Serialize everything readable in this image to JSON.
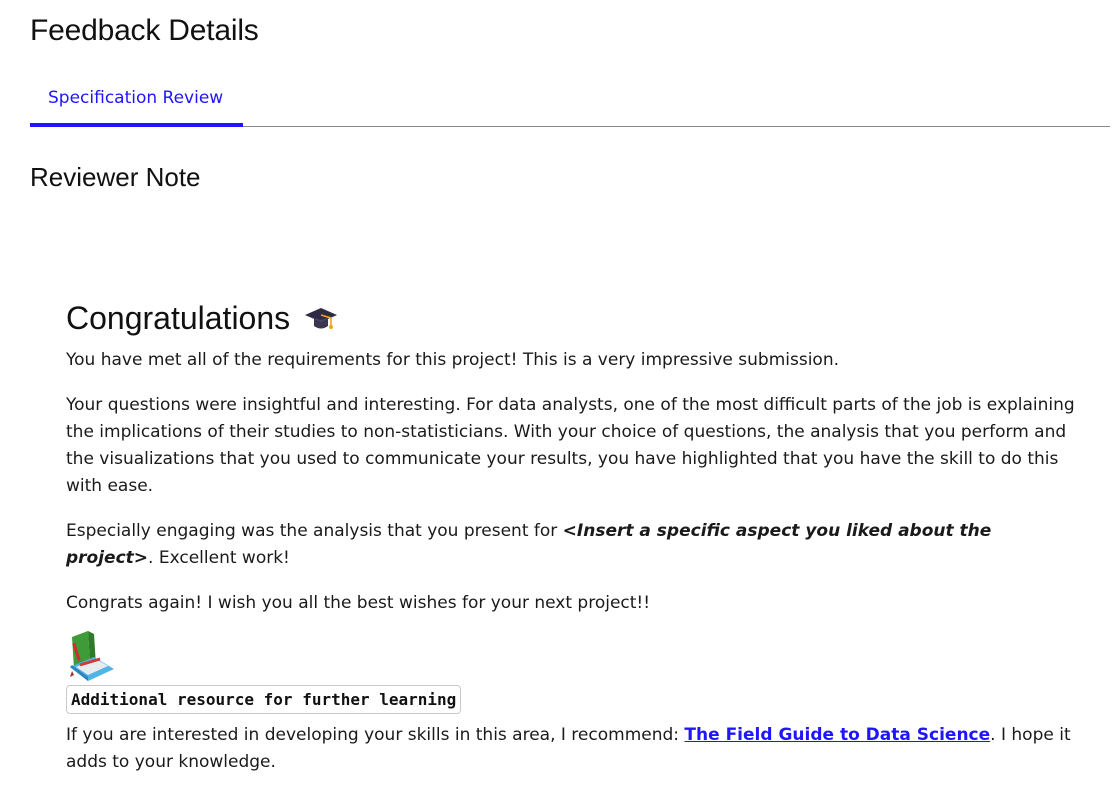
{
  "page": {
    "title": "Feedback Details"
  },
  "tabs": [
    {
      "label": "Specification Review",
      "active": true
    }
  ],
  "section": {
    "title": "Reviewer Note"
  },
  "note": {
    "heading": "Congratulations",
    "heading_icon": "graduation-cap-icon",
    "paragraph1": "You have met all of the requirements for this project! This is a very impressive submission.",
    "paragraph2": "Your questions were insightful and interesting. For data analysts, one of the most difficult parts of the job is explaining the implications of their studies to non-statisticians. With your choice of questions, the analysis that you perform and the visualizations that you used to communicate your results, you have highlighted that you have the skill to do this with ease.",
    "paragraph3_prefix": "Especially engaging was the analysis that you present for ",
    "paragraph3_emphasis": "<Insert a specific aspect you liked about the project>",
    "paragraph3_suffix": ". Excellent work!",
    "paragraph4": "Congrats again! I wish you all the best wishes for your next project!!",
    "books_icon": "books-icon",
    "resource_badge": "Additional resource for further learning",
    "resource_prefix": "If you are interested in developing your skills in this area, I recommend: ",
    "resource_link": "The Field Guide to Data Science",
    "resource_suffix": ". I hope it adds to your knowledge."
  },
  "colors": {
    "accent": "#2015ff",
    "text": "#1a1a1a",
    "divider": "#8a8a8a"
  }
}
